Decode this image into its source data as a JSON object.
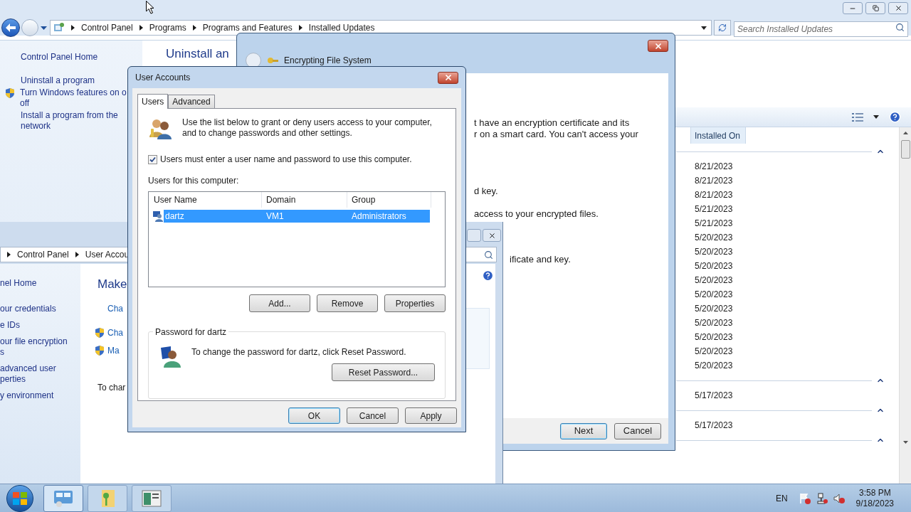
{
  "explorer": {
    "breadcrumb": [
      "Control Panel",
      "Programs",
      "Programs and Features",
      "Installed Updates"
    ],
    "search": {
      "placeholder": "Search Installed Updates"
    },
    "sidebar": [
      {
        "lines": [
          "Control Panel Home"
        ],
        "shield": false
      },
      {
        "lines": [
          "Uninstall a program"
        ],
        "shield": false
      },
      {
        "lines": [
          "Turn Windows features on o",
          "off"
        ],
        "shield": true
      },
      {
        "lines": [
          "Install a program from the",
          "network"
        ],
        "shield": false
      }
    ],
    "heading": "Uninstall an",
    "column": "Installed On",
    "groups": [
      {
        "dates": [
          "8/21/2023",
          "8/21/2023",
          "8/21/2023",
          "5/21/2023",
          "5/21/2023",
          "5/20/2023",
          "5/20/2023",
          "5/20/2023",
          "5/20/2023",
          "5/20/2023",
          "5/20/2023",
          "5/20/2023",
          "5/20/2023",
          "5/20/2023",
          "5/20/2023"
        ]
      },
      {
        "dates": [
          "5/17/2023"
        ]
      },
      {
        "dates": [
          "5/17/2023"
        ]
      }
    ]
  },
  "efs_wizard": {
    "title": "Encrypting File System",
    "lines": [
      "t have an encryption certificate and its",
      "r on a smart card. You can't access your",
      "d key.",
      "access to your encrypted files.",
      "ificate and key."
    ],
    "buttons": [
      {
        "label": "Next",
        "default": true
      },
      {
        "label": "Cancel",
        "default": false
      }
    ]
  },
  "user_accounts_window": {
    "breadcrumb": [
      "Control Panel",
      "User Accou"
    ],
    "sidebar": [
      {
        "lines": [
          "nel Home"
        ]
      },
      {
        "lines": [
          "our credentials"
        ]
      },
      {
        "lines": [
          "e IDs"
        ]
      },
      {
        "lines": [
          "our file encryption",
          "s"
        ]
      },
      {
        "lines": [
          "advanced user",
          "perties"
        ]
      },
      {
        "lines": [
          "y environment"
        ]
      }
    ],
    "heading": "Make",
    "links": [
      {
        "text": "Cha",
        "shield": false
      },
      {
        "text": "Cha",
        "shield": true
      },
      {
        "text": "Ma",
        "shield": true
      }
    ],
    "footer": "To char"
  },
  "dialog": {
    "title": "User Accounts",
    "tabs": [
      {
        "label": "Users",
        "selected": true
      },
      {
        "label": "Advanced",
        "selected": false
      }
    ],
    "intro": "Use the list below to grant or deny users access to your computer, and to change passwords and other settings.",
    "require_password": {
      "label": "Users must enter a user name and password to use this computer.",
      "checked": true
    },
    "list_label": "Users for this computer:",
    "columns": [
      "User Name",
      "Domain",
      "Group"
    ],
    "rows": [
      {
        "cells": [
          "dartz",
          "VM1",
          "Administrators"
        ],
        "selected": true
      }
    ],
    "list_buttons": [
      "Add...",
      "Remove",
      "Properties"
    ],
    "password_group": {
      "legend": "Password for dartz",
      "text": "To change the password for dartz, click Reset Password.",
      "button": "Reset Password..."
    },
    "buttons": [
      {
        "label": "OK",
        "default": true
      },
      {
        "label": "Cancel",
        "default": false
      },
      {
        "label": "Apply",
        "default": false
      }
    ]
  },
  "taskbar": {
    "apps": [
      {
        "kind": "control-panel",
        "selected": true
      },
      {
        "kind": "key-folder",
        "selected": false
      },
      {
        "kind": "window",
        "selected": false
      }
    ],
    "language": "EN",
    "time": "3:58 PM",
    "date": "9/18/2023"
  }
}
